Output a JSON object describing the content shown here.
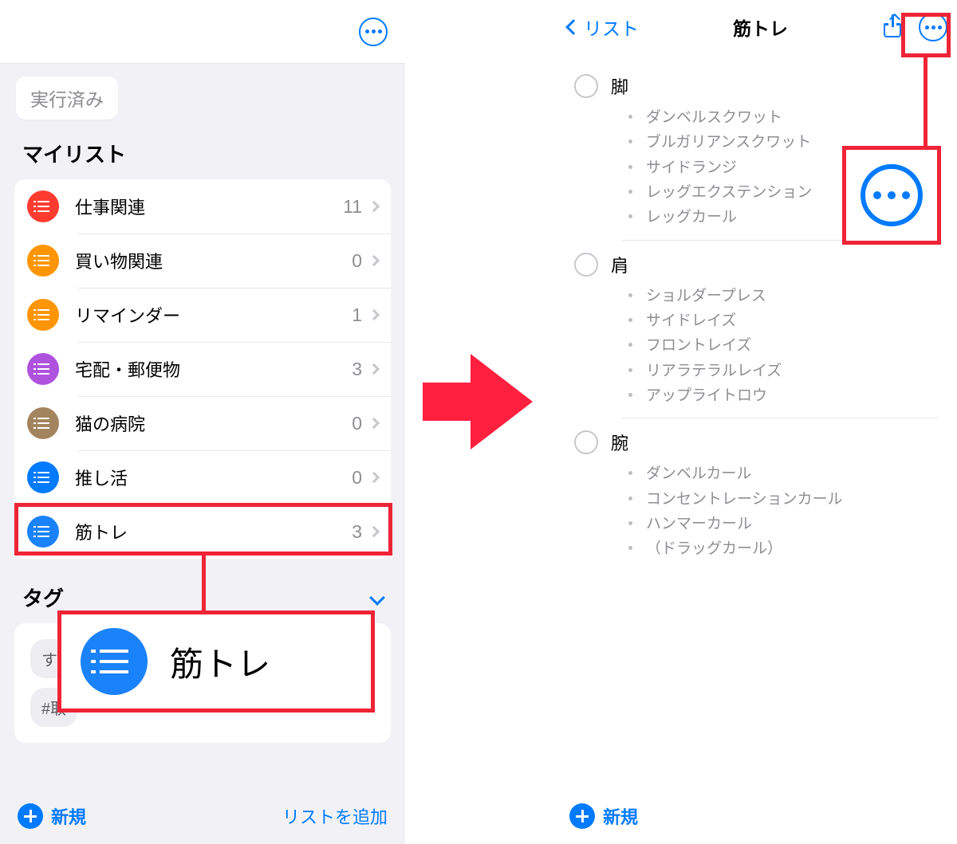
{
  "colors": {
    "accent": "#007aff",
    "annotation": "#ef2436"
  },
  "left": {
    "chip_done": "実行済み",
    "section_mylists": "マイリスト",
    "lists": [
      {
        "name": "仕事関連",
        "count": "11",
        "color": "#ff3b30"
      },
      {
        "name": "買い物関連",
        "count": "0",
        "color": "#ff9500"
      },
      {
        "name": "リマインダー",
        "count": "1",
        "color": "#ff9500"
      },
      {
        "name": "宅配・郵便物",
        "count": "3",
        "color": "#af52de"
      },
      {
        "name": "猫の病院",
        "count": "0",
        "color": "#a2845e"
      },
      {
        "name": "推し活",
        "count": "0",
        "color": "#007aff"
      },
      {
        "name": "筋トレ",
        "count": "3",
        "color": "#1a82fb"
      }
    ],
    "section_tags": "タグ",
    "tag_chips": [
      "す",
      "#取"
    ],
    "footer_new": "新規",
    "footer_add_list": "リストを追加",
    "zoom_label": "筋トレ"
  },
  "right": {
    "back_label": "リスト",
    "title": "筋トレ",
    "groups": [
      {
        "title": "脚",
        "items": [
          "ダンベルスクワット",
          "ブルガリアンスクワット",
          "サイドランジ",
          "レッグエクステンション",
          "レッグカール"
        ]
      },
      {
        "title": "肩",
        "items": [
          "ショルダープレス",
          "サイドレイズ",
          "フロントレイズ",
          "リアラテラルレイズ",
          "アップライトロウ"
        ]
      },
      {
        "title": "腕",
        "items": [
          "ダンベルカール",
          "コンセントレーションカール",
          "ハンマーカール",
          "（ドラッグカール）"
        ]
      }
    ],
    "footer_new": "新規"
  }
}
